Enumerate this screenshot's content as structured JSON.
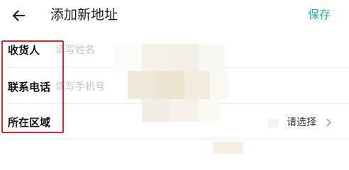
{
  "header": {
    "back_icon": "arrow-left-icon",
    "title": "添加新地址",
    "save_label": "保存",
    "accent_color": "#1fb7a6"
  },
  "form": {
    "name": {
      "label": "收货人",
      "placeholder": "填写姓名"
    },
    "phone": {
      "label": "联系电话",
      "placeholder": "填写手机号"
    },
    "region": {
      "label": "所在区域",
      "select_text": "请选择",
      "chevron_icon": "chevron-right-icon"
    }
  },
  "overlay": {
    "highlight_color": "#e3242b"
  }
}
